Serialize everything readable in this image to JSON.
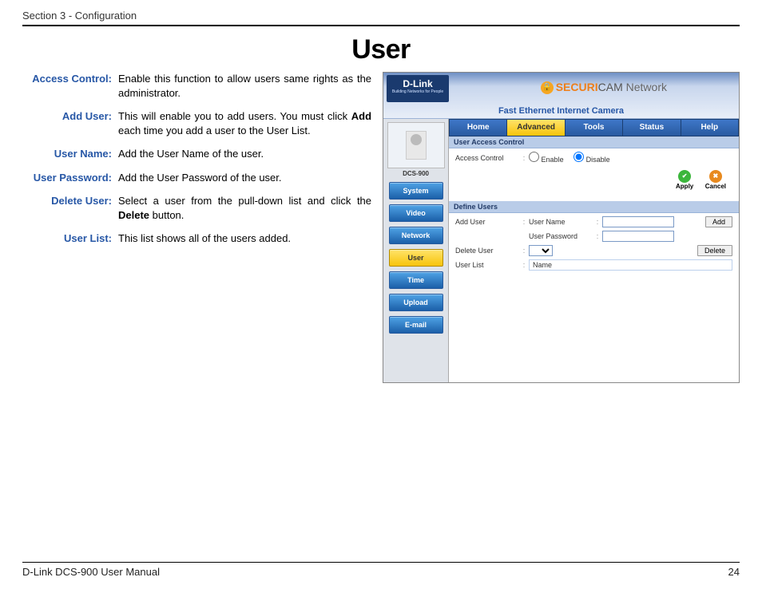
{
  "header": {
    "section": "Section 3 - Configuration"
  },
  "title": "User",
  "definitions": [
    {
      "label": "Access Control:",
      "text": "Enable this function to allow users same rights as the administrator."
    },
    {
      "label": "Add User:",
      "text": "This will enable you to add users. You must click <b>Add</b> each time you add a user to the User List."
    },
    {
      "label": "User Name:",
      "text": "Add the User Name of the user."
    },
    {
      "label": "User Password:",
      "text": "Add the User Password of the user."
    },
    {
      "label": "Delete User:",
      "text": "Select a user from the pull-down list and click the <b>Delete</b> button."
    },
    {
      "label": "User List:",
      "text": "This list shows all of the users added."
    }
  ],
  "screenshot": {
    "logo": "D-Link",
    "logo_tag": "Building Networks for People",
    "brand_prefix": "SECURI",
    "brand_suffix": "CAM",
    "brand_net": "Network",
    "subtitle": "Fast Ethernet Internet Camera",
    "model": "DCS-900",
    "side_buttons": [
      "System",
      "Video",
      "Network",
      "User",
      "Time",
      "Upload",
      "E-mail"
    ],
    "side_active": "User",
    "top_tabs": [
      "Home",
      "Advanced",
      "Tools",
      "Status",
      "Help"
    ],
    "top_active": "Advanced",
    "panel1_title": "User Access Control",
    "access_label": "Access Control",
    "enable": "Enable",
    "disable": "Disable",
    "apply": "Apply",
    "cancel": "Cancel",
    "panel2_title": "Define Users",
    "add_user": "Add User",
    "user_name": "User Name",
    "user_password": "User Password",
    "delete_user": "Delete User",
    "user_list": "User List",
    "name_col": "Name",
    "add_btn": "Add",
    "delete_btn": "Delete"
  },
  "footer": {
    "left": "D-Link DCS-900 User Manual",
    "right": "24"
  }
}
